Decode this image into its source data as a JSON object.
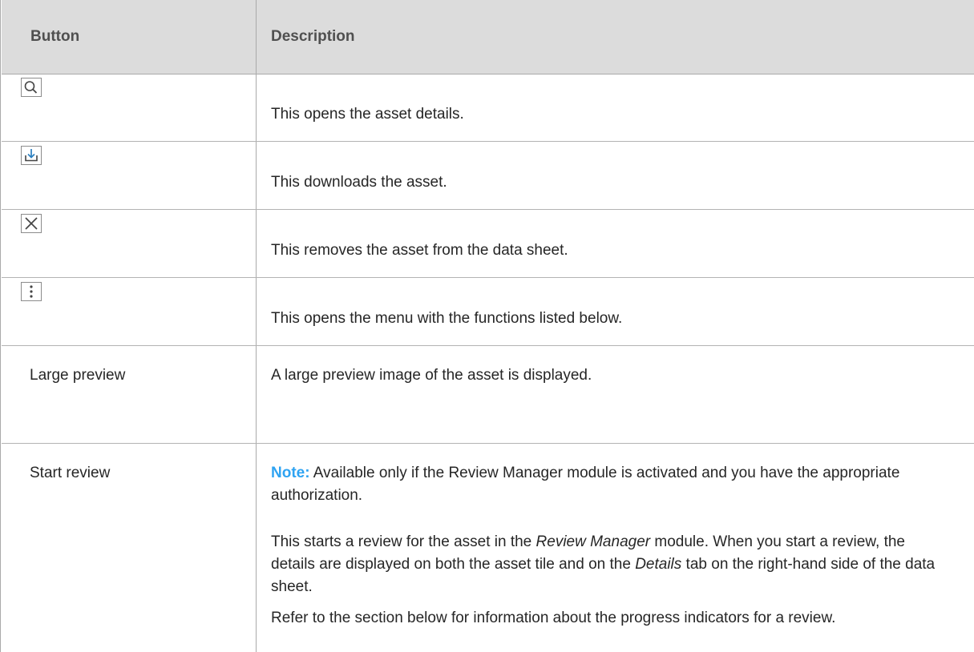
{
  "table": {
    "header": {
      "button_col": "Button",
      "description_col": "Description"
    },
    "rows": [
      {
        "icon": "search-icon",
        "description": "This opens the asset details."
      },
      {
        "icon": "download-icon",
        "description": "This downloads the asset."
      },
      {
        "icon": "close-icon",
        "description": "This removes the asset from the data sheet."
      },
      {
        "icon": "more-vertical-icon",
        "description": "This opens the menu with the functions listed below."
      },
      {
        "label": "Large preview",
        "description": "A large preview image of the asset is displayed."
      },
      {
        "label": "Start review",
        "note_label": "Note:",
        "note_text": "Available only if the Review Manager module is activated and you have the appropriate authorization.",
        "para2": {
          "t1": "This starts a review for the asset in the ",
          "em1": "Review Manager",
          "t2": " module. When you start a review, the details are displayed on both the asset tile and on the ",
          "em2": "Details",
          "t3": " tab on the right-hand side of the data sheet."
        },
        "para3": "Refer to the section below for information about the progress indicators for a review."
      }
    ]
  }
}
